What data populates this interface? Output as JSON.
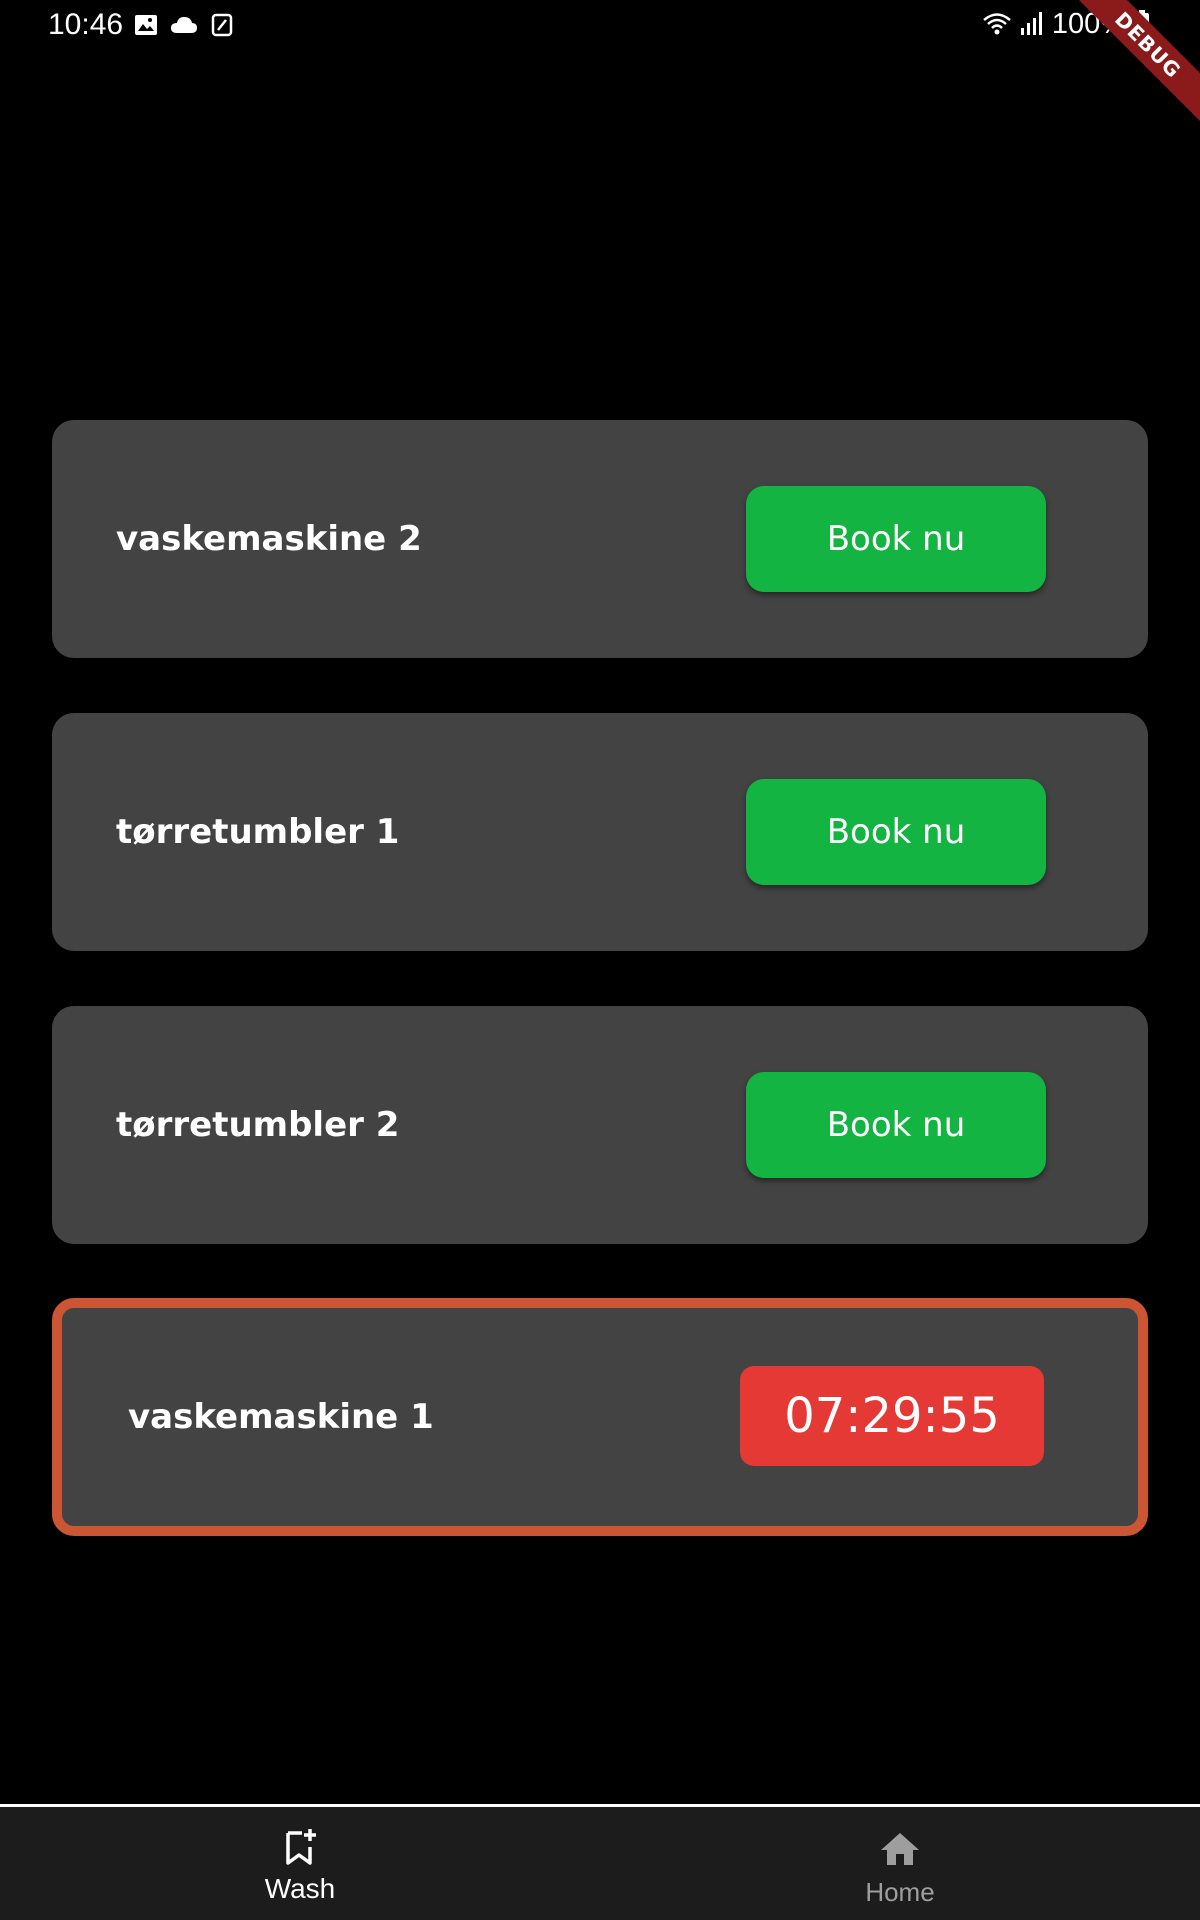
{
  "status_bar": {
    "time": "10:46",
    "battery": "100%",
    "left_icons": [
      "image-icon",
      "cloud-icon",
      "nfc-icon"
    ],
    "right_icons": [
      "wifi-icon",
      "signal-icon",
      "battery-icon"
    ]
  },
  "debug_banner": "DEBUG",
  "machines": [
    {
      "name": "vaskemaskine 2",
      "action": "Book nu"
    },
    {
      "name": "tørretumbler 1",
      "action": "Book nu"
    },
    {
      "name": "tørretumbler 2",
      "action": "Book nu"
    },
    {
      "name": "vaskemaskine 1",
      "timer": "07:29:55"
    }
  ],
  "nav": {
    "items": [
      {
        "label": "Wash",
        "icon": "bookmark-add-icon",
        "selected": true
      },
      {
        "label": "Home",
        "icon": "home-icon",
        "selected": false
      }
    ]
  },
  "colors": {
    "background": "#000000",
    "card": "#434343",
    "book_button": "#14b443",
    "timer": "#e53935",
    "active_border": "#cc5533",
    "nav_background": "#1c1c1c"
  }
}
